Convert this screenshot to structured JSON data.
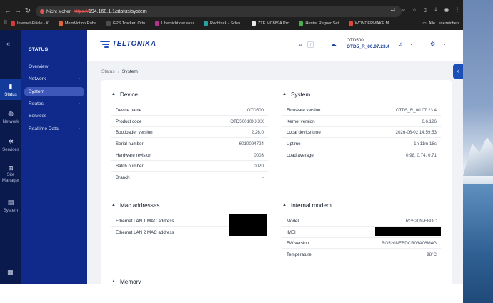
{
  "browser": {
    "security_label": "Nicht sicher",
    "url_scheme": "https://",
    "url_rest": "194.168.1.1/status/system",
    "bookmarks": [
      {
        "label": "Internet-Filiale - K...",
        "color": "#d63b3b"
      },
      {
        "label": "MemMotion Ruba...",
        "color": "#e0663a"
      },
      {
        "label": "GPS Tracker, Ortu...",
        "color": "#4d4d4d"
      },
      {
        "label": "Übersicht der aktu...",
        "color": "#b0358a"
      },
      {
        "label": "Rechteck - Schau...",
        "color": "#2aa3a0"
      },
      {
        "label": "ZTE MC889A Pro...",
        "color": "#e8e8e8"
      },
      {
        "label": "Hunter Regner Set...",
        "color": "#4caf50"
      },
      {
        "label": "WONDERMAKE M...",
        "color": "#e0463a"
      }
    ],
    "all_bookmarks": "Alle Lesezeichen"
  },
  "rail": {
    "items": [
      {
        "label": "Status",
        "icon": "signal-bars-icon",
        "glyph": "▮",
        "active": true
      },
      {
        "label": "Network",
        "icon": "globe-icon",
        "glyph": "◍",
        "active": false
      },
      {
        "label": "Services",
        "icon": "gear-icon",
        "glyph": "✲",
        "active": false
      },
      {
        "label": "Site Manager",
        "icon": "sitemap-icon",
        "glyph": "⊞",
        "active": false
      },
      {
        "label": "System",
        "icon": "document-icon",
        "glyph": "▤",
        "active": false
      }
    ]
  },
  "subnav": {
    "title": "STATUS",
    "items": [
      {
        "label": "Overview",
        "chevron": false,
        "active": false
      },
      {
        "label": "Network",
        "chevron": true,
        "active": false
      },
      {
        "label": "System",
        "chevron": false,
        "active": true
      },
      {
        "label": "Routes",
        "chevron": true,
        "active": false
      },
      {
        "label": "Services",
        "chevron": false,
        "active": false
      },
      {
        "label": "Realtime Data",
        "chevron": true,
        "active": false
      }
    ]
  },
  "header": {
    "logo_text": "TELTONIKA",
    "search_shortcut": "/",
    "device_model": "OTD500",
    "device_fw": "OTD5_R_00.07.23.4"
  },
  "breadcrumb": {
    "parent": "Status",
    "current": "System"
  },
  "sections": {
    "device": {
      "title": "Device",
      "rows": [
        {
          "k": "Device name",
          "v": "OTD500"
        },
        {
          "k": "Product code",
          "v": "OTD50010XXXX"
        },
        {
          "k": "Bootloader version",
          "v": "2.26.0"
        },
        {
          "k": "Serial number",
          "v": "6010094724"
        },
        {
          "k": "Hardware revision",
          "v": "0003"
        },
        {
          "k": "Batch number",
          "v": "0020"
        },
        {
          "k": "Branch",
          "v": "-"
        }
      ]
    },
    "system": {
      "title": "System",
      "rows": [
        {
          "k": "Firmware version",
          "v": "OTD5_R_00.07.23.4"
        },
        {
          "k": "Kernel version",
          "v": "6.6.126"
        },
        {
          "k": "Local device time",
          "v": "2026-06-02 14:59:53"
        },
        {
          "k": "Uptime",
          "v": "1h 11m 18s"
        },
        {
          "k": "Load average",
          "v": "0.98, 0.74, 0.71"
        }
      ]
    },
    "mac": {
      "title": "Mac addresses",
      "rows": [
        {
          "k": "Ethernet LAN 1 MAC address",
          "v": ""
        },
        {
          "k": "Ethernet LAN 2 MAC address",
          "v": ""
        }
      ]
    },
    "modem": {
      "title": "Internal modem",
      "rows": [
        {
          "k": "Model",
          "v": "RG520N-EBDC"
        },
        {
          "k": "IMEI",
          "v": ""
        },
        {
          "k": "FW version",
          "v": "RG520NEBDCR03A06M4G"
        },
        {
          "k": "Temperature",
          "v": "98°C"
        }
      ]
    },
    "memory": {
      "title": "Memory"
    }
  }
}
